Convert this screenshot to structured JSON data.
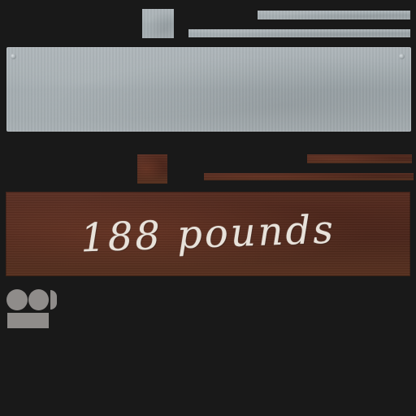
{
  "chalk_board": {
    "text": "188 pounds"
  },
  "colors": {
    "background": "#191919",
    "metal": "#a6aeb2",
    "rust": "#52291d",
    "chalk": "#e8e2da",
    "grey_piece": "#8f8c8a"
  }
}
